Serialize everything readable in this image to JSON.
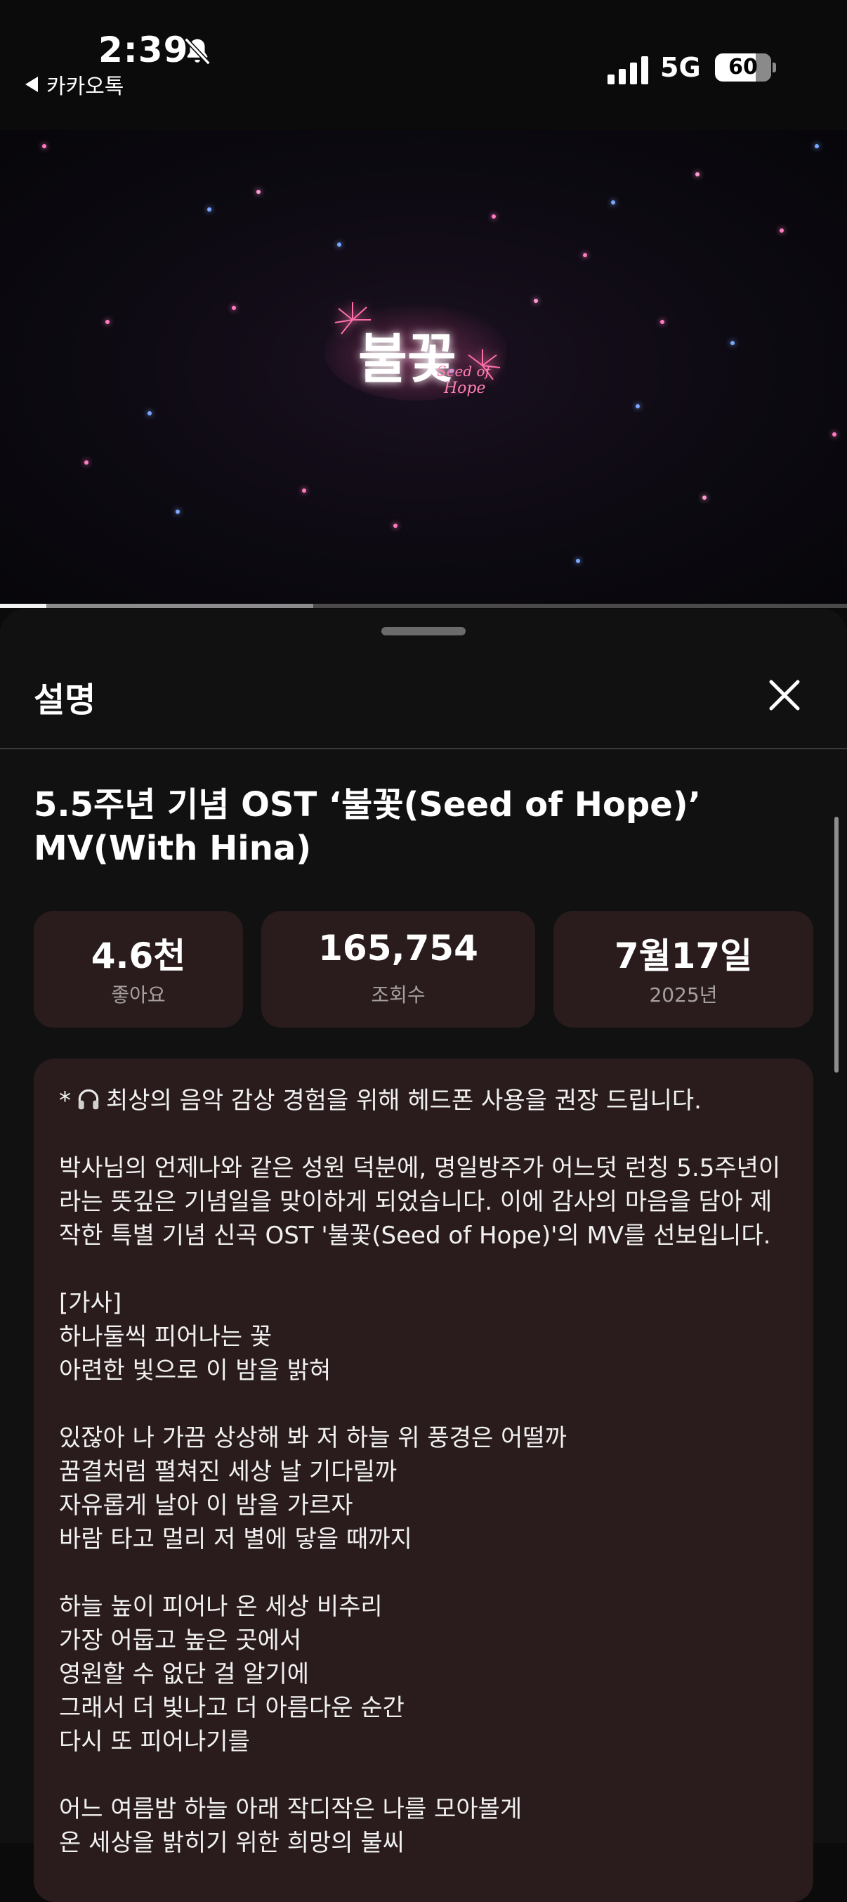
{
  "status_bar": {
    "time": "2:39",
    "back_app": "카카오톡",
    "network": "5G",
    "battery": "60",
    "battery_level": 0.6
  },
  "video": {
    "logo_text": "불꽃",
    "logo_subtext_1": "Seed of",
    "logo_subtext_2": "Hope",
    "progress_played": 0.055,
    "progress_buffered": 0.37
  },
  "sheet": {
    "title": "설명",
    "video_title": "5.5주년 기념 OST ‘불꽃(Seed of Hope)’ MV(With Hina)",
    "stats": [
      {
        "value": "4.6천",
        "label": "좋아요"
      },
      {
        "value": "165,754",
        "label": "조회수"
      },
      {
        "value": "7월17일",
        "label": "2025년"
      }
    ],
    "description": {
      "first_line_prefix": "*",
      "first_line": "최상의 음악 감상 경험을 위해 헤드폰 사용을 권장 드립니다.",
      "intro": "박사님의 언제나와 같은 성원 덕분에, 명일방주가 어느덧 런칭 5.5주년이라는 뜻깊은 기념일을 맞이하게 되었습니다. 이에 감사의 마음을 담아 제작한 특별 기념 신곡 OST '불꽃(Seed of Hope)'의 MV를 선보입니다.",
      "lyrics_header": "[가사]",
      "stanza1": [
        "하나둘씩 피어나는 꽃",
        "아련한 빛으로 이 밤을 밝혀"
      ],
      "stanza2": [
        "있잖아 나 가끔 상상해 봐 저 하늘 위 풍경은 어떨까",
        "꿈결처럼 펼쳐진 세상 날 기다릴까",
        "자유롭게 날아 이 밤을 가르자",
        "바람 타고 멀리 저 별에 닿을 때까지"
      ],
      "stanza3": [
        "하늘 높이 피어나 온 세상 비추리",
        "가장 어둡고 높은 곳에서",
        "영원할 수 없단 걸 알기에",
        "그래서 더 빛나고 더 아름다운 순간",
        "다시 또 피어나기를"
      ],
      "stanza4": [
        "어느 여름밤 하늘 아래 작디작은 나를 모아볼게",
        "온 세상을 밝히기 위한 희망의 불씨"
      ]
    }
  }
}
